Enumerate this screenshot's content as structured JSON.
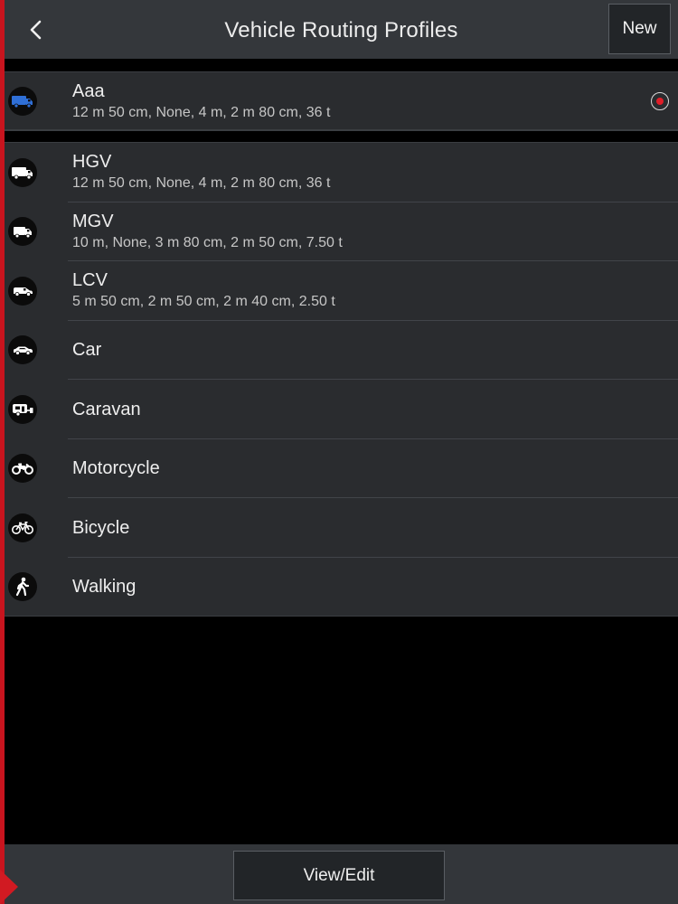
{
  "header": {
    "title": "Vehicle Routing Profiles",
    "back_icon": "chevron-left-icon",
    "new_label": "New"
  },
  "custom_profiles": [
    {
      "name": "Aaa",
      "detail": "12 m 50 cm, None, 4 m, 2 m 80 cm, 36 t",
      "icon": "truck-icon",
      "icon_color": "#2f6fd6",
      "selected": true
    }
  ],
  "builtin_profiles": [
    {
      "name": "HGV",
      "detail": "12 m 50 cm, None, 4 m, 2 m 80 cm, 36 t",
      "icon": "hgv-truck-icon"
    },
    {
      "name": "MGV",
      "detail": "10 m, None, 3 m 80 cm, 2 m 50 cm, 7.50 t",
      "icon": "mgv-truck-icon"
    },
    {
      "name": "LCV",
      "detail": "5 m 50 cm, 2 m 50 cm, 2 m 40 cm, 2.50 t",
      "icon": "van-icon"
    },
    {
      "name": "Car",
      "detail": "",
      "icon": "car-icon"
    },
    {
      "name": "Caravan",
      "detail": "",
      "icon": "caravan-icon"
    },
    {
      "name": "Motorcycle",
      "detail": "",
      "icon": "motorcycle-icon"
    },
    {
      "name": "Bicycle",
      "detail": "",
      "icon": "bicycle-icon"
    },
    {
      "name": "Walking",
      "detail": "",
      "icon": "walking-icon"
    }
  ],
  "footer": {
    "view_edit_label": "View/Edit"
  },
  "colors": {
    "accent": "#c8141e",
    "radio_selected": "#e01e28",
    "header_bg": "#34373b",
    "row_bg": "#2a2c2f"
  }
}
